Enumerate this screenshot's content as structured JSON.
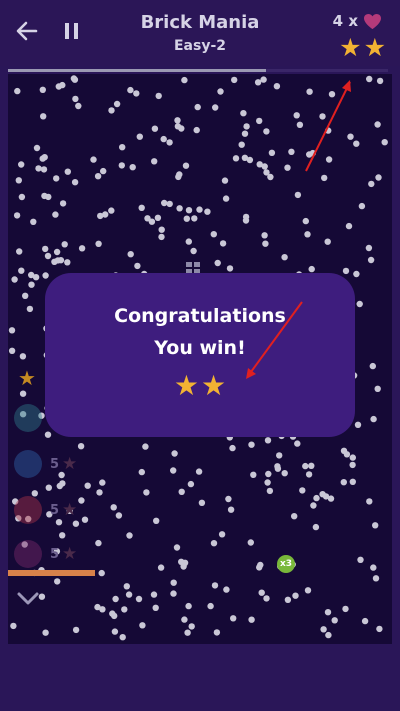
{
  "header": {
    "title": "Brick Mania",
    "level": "Easy-2",
    "lives_text": "4 x",
    "stars_earned": 2,
    "progress": 0.68
  },
  "dialog": {
    "line1": "Congratulations",
    "line2": "You win!",
    "stars": 2
  },
  "powerups": [
    {
      "name": "bomb",
      "count": "5",
      "color": "#2f7a8a"
    },
    {
      "name": "speed",
      "count": "5",
      "color": "#2e63a8"
    },
    {
      "name": "fire",
      "count": "5",
      "color": "#a8334a"
    },
    {
      "name": "split",
      "count": "5",
      "color": "#7a2a6a"
    }
  ],
  "field": {
    "ball_multiplier_label": "x3"
  },
  "colors": {
    "accent_star": "#f2b233",
    "heart": "#b43a7a",
    "annotation_arrow": "#e02020"
  }
}
